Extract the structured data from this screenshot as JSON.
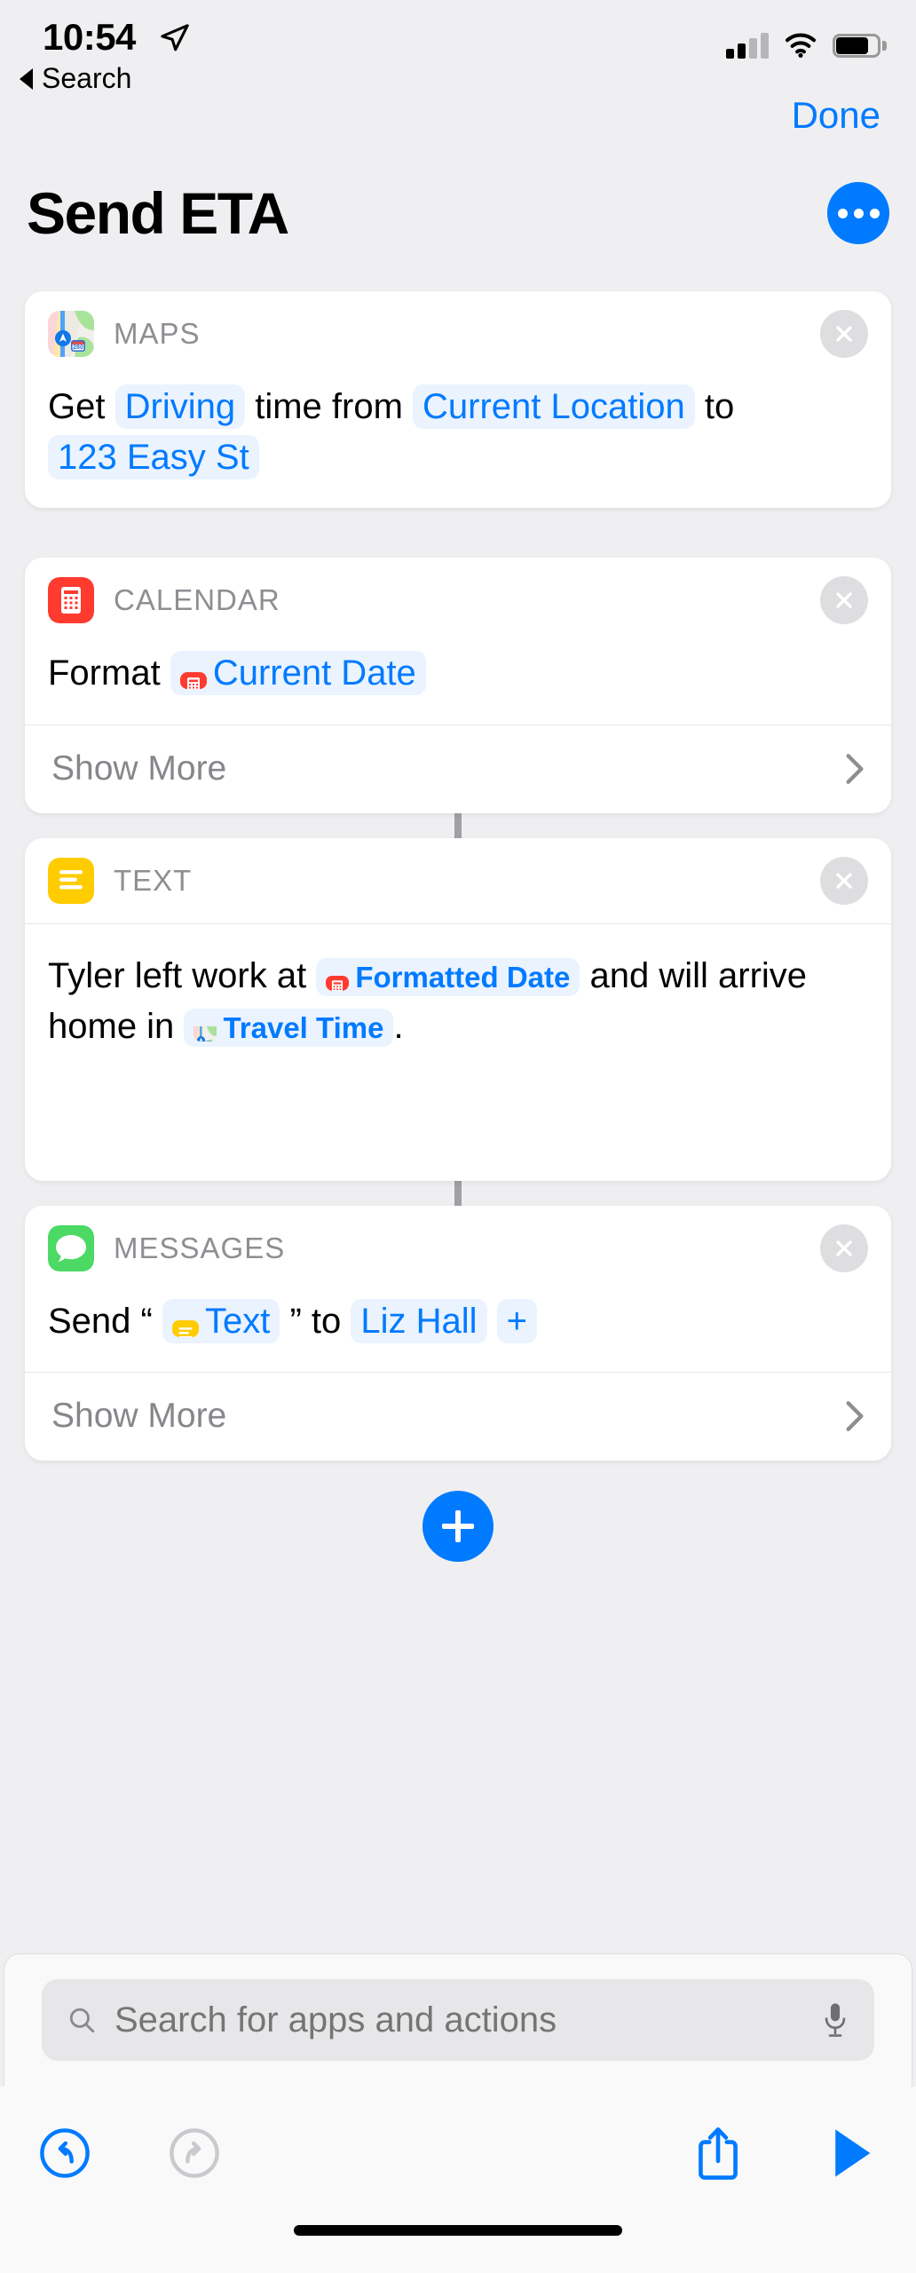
{
  "status_bar": {
    "time": "10:54",
    "location_icon": "location-arrow-icon",
    "cellular_icon": "cellular-bars-icon",
    "wifi_icon": "wifi-icon",
    "battery_icon": "battery-icon",
    "battery_level_pct": 66,
    "signal_bars_filled": 2,
    "signal_bars_total": 4
  },
  "back": {
    "label": "Search",
    "icon": "back-triangle-icon"
  },
  "nav": {
    "done_label": "Done",
    "title": "Send ETA",
    "more_icon": "ellipsis-icon"
  },
  "colors": {
    "accent_blue": "#007AFF",
    "token_bg": "#EAF3FE",
    "page_bg": "#EFEFF1",
    "card_bg": "#FFFFFF",
    "app_label_gray": "#8E8E93",
    "close_gray": "#DEDEE0",
    "calendar_red": "#FF3B30",
    "text_yellow": "#FFCC00",
    "messages_green": "#4CD964",
    "connector_gray": "#A0A0A6"
  },
  "actions": [
    {
      "app": "MAPS",
      "app_icon": "maps-icon",
      "close_icon": "close-icon",
      "parts": [
        {
          "type": "text",
          "value": "Get"
        },
        {
          "type": "token",
          "value": "Driving"
        },
        {
          "type": "text",
          "value": "time from"
        },
        {
          "type": "token",
          "value": "Current Location"
        },
        {
          "type": "text",
          "value": "to"
        },
        {
          "type": "token",
          "value": "123 Easy St"
        }
      ],
      "show_more": null
    },
    {
      "app": "CALENDAR",
      "app_icon": "calendar-icon",
      "close_icon": "close-icon",
      "parts": [
        {
          "type": "text",
          "value": "Format"
        },
        {
          "type": "token",
          "value": "Current Date",
          "icon": "calendar-icon"
        }
      ],
      "show_more": {
        "label": "Show More",
        "chevron_icon": "chevron-right-icon"
      }
    },
    {
      "app": "TEXT",
      "app_icon": "text-icon",
      "close_icon": "close-icon",
      "parts": [
        {
          "type": "text",
          "value": "Tyler left work at"
        },
        {
          "type": "token",
          "value": "Formatted Date",
          "icon": "calendar-icon",
          "small": true
        },
        {
          "type": "text",
          "value": "and will arrive home in"
        },
        {
          "type": "token",
          "value": "Travel Time",
          "icon": "maps-icon",
          "small": true
        },
        {
          "type": "text",
          "value": "."
        }
      ],
      "show_more": null
    },
    {
      "app": "MESSAGES",
      "app_icon": "messages-icon",
      "close_icon": "close-icon",
      "parts": [
        {
          "type": "text",
          "value": "Send “"
        },
        {
          "type": "token",
          "value": "Text",
          "icon": "text-icon"
        },
        {
          "type": "text",
          "value": "” to"
        },
        {
          "type": "token",
          "value": "Liz Hall"
        },
        {
          "type": "token",
          "value": "+"
        }
      ],
      "show_more": {
        "label": "Show More",
        "chevron_icon": "chevron-right-icon"
      }
    }
  ],
  "add_action": {
    "icon": "plus-icon",
    "label": "+"
  },
  "search": {
    "placeholder": "Search for apps and actions",
    "value": "",
    "search_icon": "search-icon",
    "mic_icon": "microphone-icon"
  },
  "toolbar": {
    "undo_icon": "undo-icon",
    "undo_enabled": true,
    "redo_icon": "redo-icon",
    "redo_enabled": false,
    "share_icon": "share-icon",
    "play_icon": "play-icon"
  }
}
